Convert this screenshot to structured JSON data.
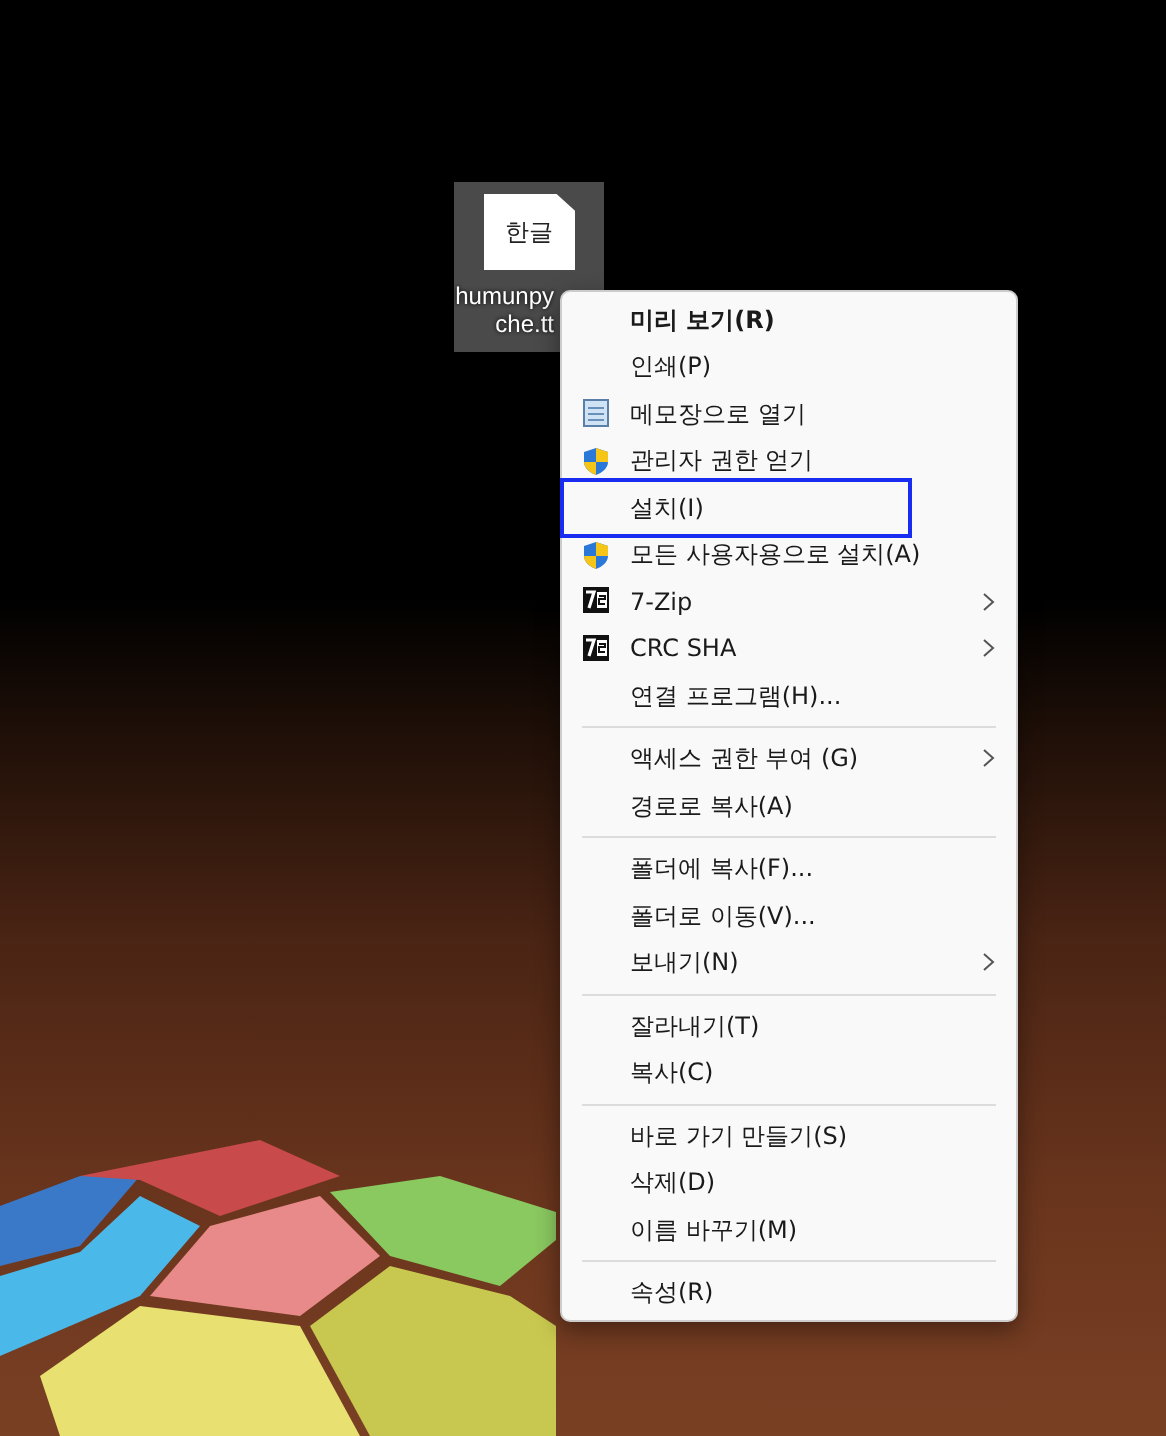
{
  "desktop_icon": {
    "preview_text": "한글",
    "label_lines": [
      "humunpy",
      "che.tt"
    ],
    "selected": true
  },
  "context_menu": {
    "groups": [
      [
        {
          "label": "미리 보기(R)",
          "kind": "plain",
          "bold": true,
          "submenu": false,
          "highlighted": false
        },
        {
          "label": "인쇄(P)",
          "kind": "plain",
          "bold": false,
          "submenu": false,
          "highlighted": false
        },
        {
          "label": "메모장으로  열기",
          "kind": "notepad",
          "bold": false,
          "submenu": false,
          "highlighted": false
        },
        {
          "label": "관리자 권한 얻기",
          "kind": "shield",
          "bold": false,
          "submenu": false,
          "highlighted": false
        },
        {
          "label": "설치(I)",
          "kind": "plain",
          "bold": false,
          "submenu": false,
          "highlighted": true
        },
        {
          "label": "모든 사용자용으로 설치(A)",
          "kind": "shield",
          "bold": false,
          "submenu": false,
          "highlighted": false
        },
        {
          "label": "7-Zip",
          "kind": "archive",
          "bold": false,
          "submenu": true,
          "highlighted": false
        },
        {
          "label": "CRC SHA",
          "kind": "archive",
          "bold": false,
          "submenu": true,
          "highlighted": false
        },
        {
          "label": "연결 프로그램(H)...",
          "kind": "plain",
          "bold": false,
          "submenu": false,
          "highlighted": false
        }
      ],
      [
        {
          "label": "액세스 권한 부여 (G)",
          "kind": "plain",
          "bold": false,
          "submenu": true,
          "highlighted": false
        },
        {
          "label": "경로로 복사(A)",
          "kind": "plain",
          "bold": false,
          "submenu": false,
          "highlighted": false
        }
      ],
      [
        {
          "label": "폴더에 복사(F)...",
          "kind": "plain",
          "bold": false,
          "submenu": false,
          "highlighted": false
        },
        {
          "label": "폴더로 이동(V)...",
          "kind": "plain",
          "bold": false,
          "submenu": false,
          "highlighted": false
        },
        {
          "label": "보내기(N)",
          "kind": "plain",
          "bold": false,
          "submenu": true,
          "highlighted": false
        }
      ],
      [
        {
          "label": "잘라내기(T)",
          "kind": "plain",
          "bold": false,
          "submenu": false,
          "highlighted": false
        },
        {
          "label": "복사(C)",
          "kind": "plain",
          "bold": false,
          "submenu": false,
          "highlighted": false
        }
      ],
      [
        {
          "label": "바로 가기 만들기(S)",
          "kind": "plain",
          "bold": false,
          "submenu": false,
          "highlighted": false
        },
        {
          "label": "삭제(D)",
          "kind": "plain",
          "bold": false,
          "submenu": false,
          "highlighted": false
        },
        {
          "label": "이름 바꾸기(M)",
          "kind": "plain",
          "bold": false,
          "submenu": false,
          "highlighted": false
        }
      ],
      [
        {
          "label": "속성(R)",
          "kind": "plain",
          "bold": false,
          "submenu": false,
          "highlighted": false
        }
      ]
    ]
  }
}
